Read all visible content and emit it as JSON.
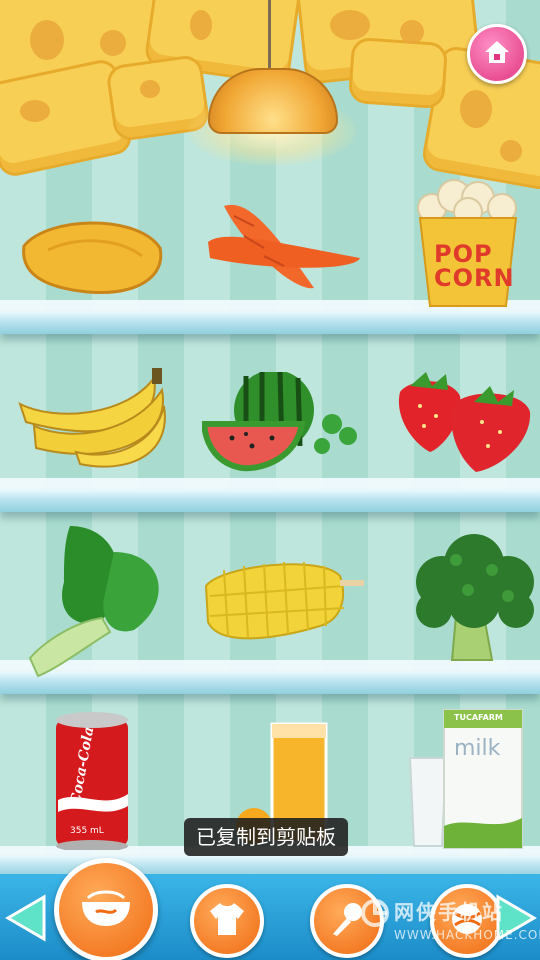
{
  "toast": {
    "text": "已复制到剪贴板"
  },
  "top": {
    "home_button": "home-icon"
  },
  "shelves": [
    {
      "items": [
        {
          "name": "potato-chip"
        },
        {
          "name": "carrots"
        },
        {
          "name": "popcorn",
          "label_top": "POP",
          "label_bottom": "CORN"
        }
      ]
    },
    {
      "items": [
        {
          "name": "bananas"
        },
        {
          "name": "watermelon"
        },
        {
          "name": "strawberries"
        }
      ]
    },
    {
      "items": [
        {
          "name": "bok-choy"
        },
        {
          "name": "corn-cob"
        },
        {
          "name": "broccoli"
        }
      ]
    },
    {
      "items": [
        {
          "name": "cola-can",
          "brand": "Coca-Cola",
          "volume": "355 mL"
        },
        {
          "name": "orange-juice"
        },
        {
          "name": "milk-carton",
          "label": "milk",
          "brand": "TUCAFARM"
        }
      ]
    }
  ],
  "bottom_bar": {
    "left_arrow": "arrow-left-icon",
    "categories": [
      {
        "name": "food-category",
        "icon": "bowl-icon",
        "selected": true
      },
      {
        "name": "clothes-category",
        "icon": "shirt-icon"
      },
      {
        "name": "music-category",
        "icon": "microphone-icon"
      },
      {
        "name": "toys-category",
        "icon": "ball-icon"
      }
    ],
    "right_arrow": "arrow-right-icon"
  },
  "watermark": {
    "title": "网侠手机站",
    "url": "WWW.HACKHOME.COM"
  },
  "colors": {
    "shelf": "#8fd0df",
    "bar": "#1c8cc8",
    "accent": "#f06a12",
    "home": "#e0357f",
    "toast_bg": "#1e1e1e"
  }
}
